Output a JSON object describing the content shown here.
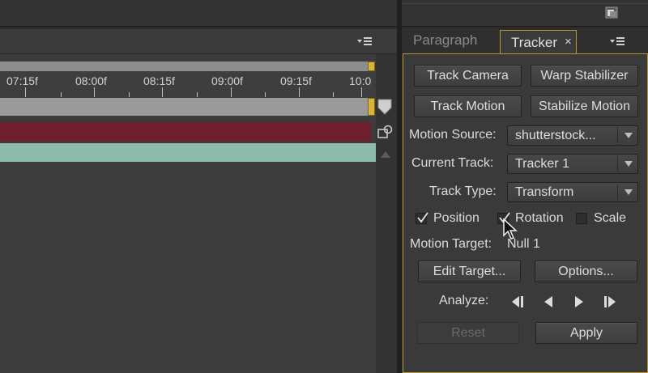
{
  "timeline": {
    "ticks": [
      "07:15f",
      "08:00f",
      "08:15f",
      "09:00f",
      "09:15f",
      "10:0"
    ]
  },
  "tracker": {
    "tabs": {
      "paragraph": "Paragraph",
      "tracker": "Tracker",
      "close": "×"
    },
    "buttons": {
      "track_camera": "Track Camera",
      "warp_stabilizer": "Warp Stabilizer",
      "track_motion": "Track Motion",
      "stabilize_motion": "Stabilize Motion",
      "edit_target": "Edit Target...",
      "options": "Options...",
      "reset": "Reset",
      "apply": "Apply"
    },
    "motion_source": {
      "label": "Motion Source:",
      "value": "shutterstock..."
    },
    "current_track": {
      "label": "Current Track:",
      "value": "Tracker 1"
    },
    "track_type": {
      "label": "Track Type:",
      "value": "Transform"
    },
    "checkboxes": [
      {
        "label": "Position",
        "checked": true
      },
      {
        "label": "Rotation",
        "checked": true
      },
      {
        "label": "Scale",
        "checked": false
      }
    ],
    "motion_target": {
      "label": "Motion Target:",
      "value": "Null 1"
    },
    "analyze": {
      "label": "Analyze:"
    }
  },
  "colors": {
    "accent_border": "#b7962c",
    "layer_red": "#6e1e2c",
    "layer_teal": "#8dbcae",
    "end_marker": "#d9b43b"
  },
  "icons": [
    "trash-icon",
    "panel-menu-icon",
    "cti-head-icon",
    "comp-icon",
    "scroll-up-icon",
    "analyze-back-one-icon",
    "analyze-backward-icon",
    "analyze-forward-icon",
    "analyze-forward-one-icon",
    "mouse-cursor-icon",
    "checkmark-icon",
    "dropdown-caret-icon"
  ]
}
